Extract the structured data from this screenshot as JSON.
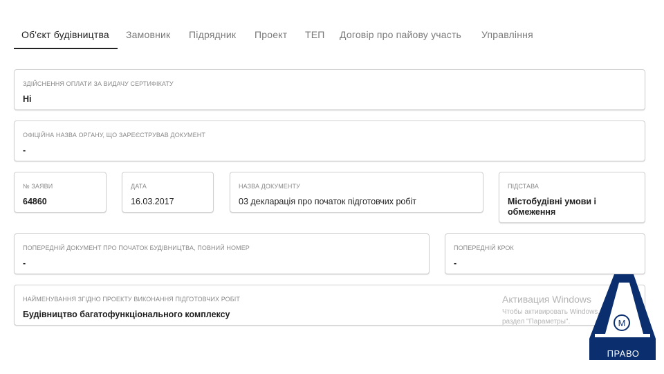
{
  "tabs": [
    {
      "label": "Об'єкт будівництва",
      "active": true
    },
    {
      "label": "Замовник",
      "active": false
    },
    {
      "label": "Підрядник",
      "active": false
    },
    {
      "label": "Проект",
      "active": false
    },
    {
      "label": "ТЕП",
      "active": false
    },
    {
      "label": "Договір про пайову участь",
      "active": false
    },
    {
      "label": "Управління",
      "active": false
    }
  ],
  "fields": {
    "certificate_payment": {
      "label": "Здійснення оплати за видачу сертифікату",
      "value": "Ні"
    },
    "registering_body": {
      "label": "Офіційна назва органу, що зареєстрував документ",
      "value": "-"
    },
    "application_no": {
      "label": "№ заяви",
      "value": "64860"
    },
    "date": {
      "label": "Дата",
      "value": "16.03.2017"
    },
    "document_name": {
      "label": "Назва документу",
      "value": "03 декларація про початок підготовчих робіт"
    },
    "basis": {
      "label": "Підстава",
      "value": "Містобудівні умови і обмеження"
    },
    "previous_document": {
      "label": "Попередній документ про початок будівництва, повний номер",
      "value": "-"
    },
    "previous_step": {
      "label": "Попередній крок",
      "value": "-"
    },
    "project_name": {
      "label": "Найменування згідно проекту виконання підготовчих робіт",
      "value": "Будівництво багатофункціонального комплексу"
    }
  },
  "watermark": {
    "title": "Активация Windows",
    "line1": "Чтобы активировать Windows, перейдите в",
    "line2": "раздел \"Параметры\"."
  },
  "logo": {
    "text": "ПРАВО",
    "letter": "А",
    "mark": "М",
    "color": "#0b2f6e",
    "brand_name": "АМ ПРАВО"
  }
}
